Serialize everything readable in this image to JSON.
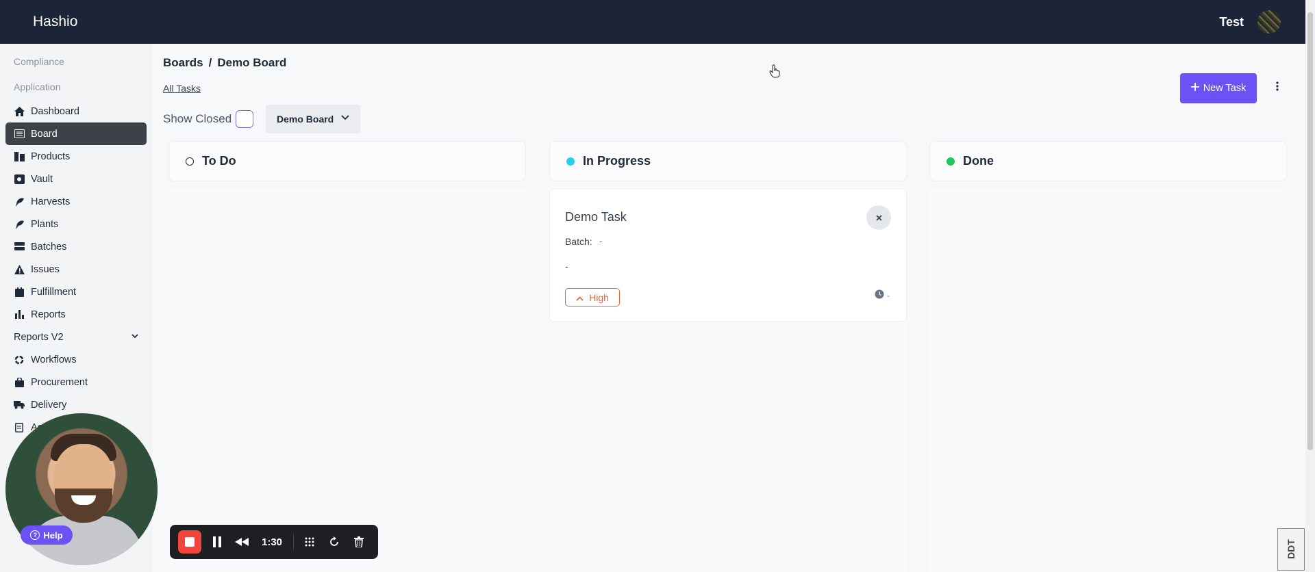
{
  "app": {
    "brand": "Hashio",
    "user_name": "Test"
  },
  "sidebar": {
    "sections": [
      "Compliance",
      "Application"
    ],
    "items": [
      {
        "label": "Dashboard",
        "icon": "home-icon"
      },
      {
        "label": "Board",
        "icon": "board-icon",
        "active": true
      },
      {
        "label": "Products",
        "icon": "products-icon"
      },
      {
        "label": "Vault",
        "icon": "vault-icon"
      },
      {
        "label": "Harvests",
        "icon": "harvest-icon"
      },
      {
        "label": "Plants",
        "icon": "plant-icon"
      },
      {
        "label": "Batches",
        "icon": "batches-icon"
      },
      {
        "label": "Issues",
        "icon": "warning-icon"
      },
      {
        "label": "Fulfillment",
        "icon": "fulfillment-icon"
      },
      {
        "label": "Reports",
        "icon": "bar-chart-icon"
      },
      {
        "label": "Reports V2",
        "icon": "",
        "expandable": true
      },
      {
        "label": "Workflows",
        "icon": "workflow-icon"
      },
      {
        "label": "Procurement",
        "icon": "bag-icon"
      },
      {
        "label": "Delivery",
        "icon": "truck-icon"
      },
      {
        "label": "Acti",
        "icon": "clipboard-icon"
      }
    ]
  },
  "header": {
    "breadcrumb_root": "Boards",
    "breadcrumb_sep": "/",
    "breadcrumb_current": "Demo Board",
    "all_tasks_link": "All Tasks",
    "show_closed_label": "Show Closed",
    "board_select_value": "Demo Board",
    "new_task_label": "New Task"
  },
  "columns": [
    {
      "title": "To Do",
      "dot_color": "#ffffff",
      "dot_border": "#1f2937"
    },
    {
      "title": "In Progress",
      "dot_color": "#22d3ee"
    },
    {
      "title": "Done",
      "dot_color": "#22c55e"
    }
  ],
  "task": {
    "title": "Demo Task",
    "batch_label": "Batch:",
    "batch_value": "-",
    "description": "-",
    "priority": "High",
    "priority_color": "#e2673a",
    "due": "-"
  },
  "help": {
    "label": "Help"
  },
  "recorder": {
    "time": "1:30"
  },
  "corner_badge": "DDT",
  "colors": {
    "topbar": "#1c2537",
    "accent": "#6a52f5",
    "active_nav": "#3d4148",
    "record": "#f0453a"
  }
}
